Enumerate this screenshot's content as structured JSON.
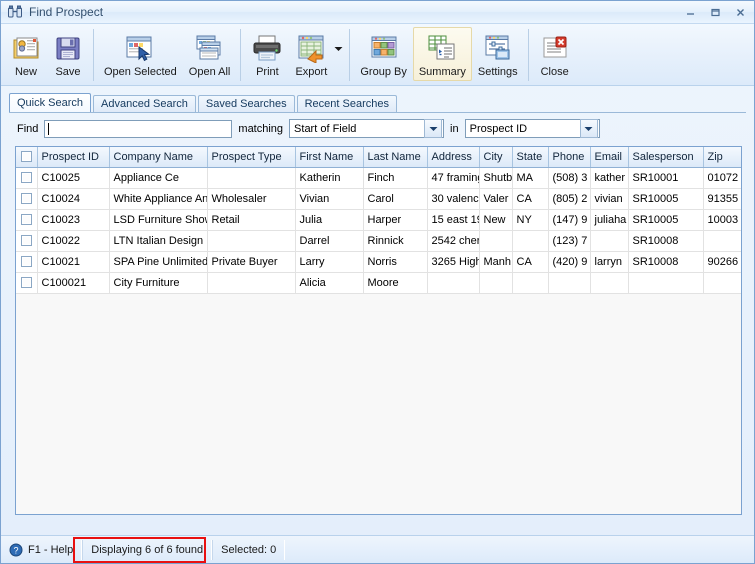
{
  "window": {
    "title": "Find Prospect",
    "icon": "binoculars-icon",
    "controls": {
      "minimize": "minimize-icon",
      "maximize": "maximize-icon",
      "close": "close-icon"
    }
  },
  "toolbar": {
    "buttons": [
      {
        "label": "New",
        "icon": "new-record-icon"
      },
      {
        "label": "Save",
        "icon": "floppy-disk-icon"
      },
      {
        "label": "Open Selected",
        "icon": "open-selected-icon"
      },
      {
        "label": "Open All",
        "icon": "open-all-icon"
      },
      {
        "label": "Print",
        "icon": "printer-icon"
      },
      {
        "label": "Export",
        "icon": "export-icon"
      },
      {
        "label": "Group By",
        "icon": "group-by-icon"
      },
      {
        "label": "Summary",
        "icon": "summary-icon"
      },
      {
        "label": "Settings",
        "icon": "settings-icon"
      },
      {
        "label": "Close",
        "icon": "close-window-icon"
      }
    ],
    "export_dropdown_arrow": "chevron-down-icon",
    "hovered_button": "Summary"
  },
  "tabs": [
    {
      "label": "Quick Search",
      "active": true
    },
    {
      "label": "Advanced Search",
      "active": false
    },
    {
      "label": "Saved Searches",
      "active": false
    },
    {
      "label": "Recent Searches",
      "active": false
    }
  ],
  "search": {
    "find_label": "Find",
    "find_value": "",
    "find_placeholder": "",
    "matching_label": "matching",
    "matching_value": "Start of Field",
    "in_label": "in",
    "in_value": "Prospect ID"
  },
  "grid": {
    "columns": [
      "Prospect ID",
      "Company Name",
      "Prospect Type",
      "First Name",
      "Last Name",
      "Address",
      "City",
      "State",
      "Phone",
      "Email",
      "Salesperson",
      "Zip"
    ],
    "rows": [
      {
        "checked": false,
        "cells": [
          "C10025",
          "Appliance Ce",
          "",
          "Katherin",
          "Finch",
          "47 framing",
          "Shutb",
          "MA",
          "(508) 3",
          "kather",
          "SR10001",
          "01072"
        ]
      },
      {
        "checked": false,
        "cells": [
          "C10024",
          "White Appliance An",
          "Wholesaler",
          "Vivian",
          "Carol",
          "30 valenci",
          "Valer",
          "CA",
          "(805) 2",
          "vivian",
          "SR10005",
          "91355"
        ]
      },
      {
        "checked": false,
        "cells": [
          "C10023",
          "LSD Furniture Show",
          "Retail",
          "Julia",
          "Harper",
          "15 east 19",
          "New",
          "NY",
          "(147) 9",
          "juliaha",
          "SR10005",
          "10003"
        ]
      },
      {
        "checked": false,
        "cells": [
          "C10022",
          "LTN Italian Design",
          "",
          "Darrel",
          "Rinnick",
          "2542 cher",
          "",
          "",
          "(123) 7",
          "",
          "SR10008",
          ""
        ]
      },
      {
        "checked": false,
        "cells": [
          "C10021",
          "SPA Pine Unlimited",
          "Private Buyer",
          "Larry",
          "Norris",
          "3265 High",
          "Manh",
          "CA",
          "(420) 9",
          "larryn",
          "SR10008",
          "90266"
        ]
      },
      {
        "checked": false,
        "cells": [
          "C100021",
          "City Furniture",
          "",
          "Alicia",
          "Moore",
          "",
          "",
          "",
          "",
          "",
          "",
          ""
        ]
      }
    ]
  },
  "statusbar": {
    "help": "F1 - Help",
    "help_icon": "help-circle-icon",
    "displaying": "Displaying 6 of 6 found",
    "selected": "Selected: 0"
  },
  "colors": {
    "accent": "#7ba2d0",
    "highlight_box": "#e81010",
    "titlebar_text": "#33506f"
  }
}
